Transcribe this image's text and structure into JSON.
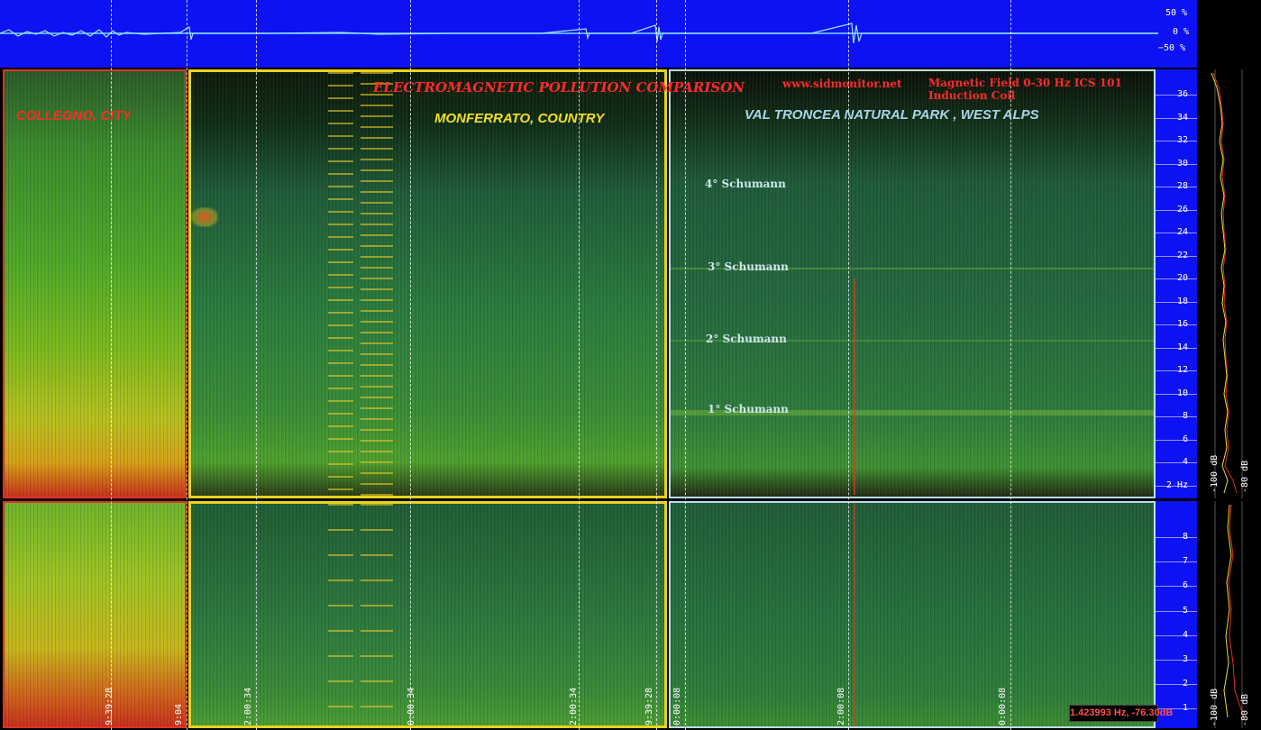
{
  "titles": {
    "main": "ELECTROMAGNETIC POLLUTION COMPARISON",
    "website": "www.sidmonitor.net",
    "sensor_line1": "Magnetic Field 0-30 Hz ICS 101",
    "sensor_line2": "Induction Coil"
  },
  "locations": {
    "city": "COLLEGNO, CITY",
    "country": "MONFERRATO, COUNTRY",
    "park": "VAL TRONCEA NATURAL PARK , WEST ALPS"
  },
  "schumann": {
    "s4": "4° Schumann",
    "s3": "3° Schumann",
    "s2": "2° Schumann",
    "s1": "1° Schumann"
  },
  "waveform_axis": {
    "plus": "50 %",
    "zero": "0 %",
    "minus": "−50 %"
  },
  "freq_axis_top": [
    "36",
    "34",
    "32",
    "30",
    "28",
    "26",
    "24",
    "22",
    "20",
    "18",
    "16",
    "14",
    "12",
    "10",
    "8",
    "6",
    "4",
    "2 Hz"
  ],
  "freq_axis_bottom": [
    "8",
    "7",
    "6",
    "5",
    "4",
    "3",
    "2",
    "1"
  ],
  "spectrum_labels": {
    "top_left": "-100 dB",
    "top_right": "-80 dB",
    "bottom_left": "-100 dB",
    "bottom_right": "-80 dB"
  },
  "time_labels": {
    "t1": "2:00:34",
    "t2": "0:00:34",
    "t3": "2:00:34",
    "t4": "9:39:28",
    "t5": "0:00:08",
    "t6": "2:00:08",
    "t7": "0:00:08",
    "t8": "2:00:08",
    "t9": "9:04"
  },
  "readout": "1.423993 Hz, -76.30dB",
  "colors": {
    "axis_blue": "#0d12f2",
    "city_border": "#e0322a",
    "country_border": "#e8d21c",
    "park_border": "#b8dce8",
    "title_red": "#ff2a2a",
    "country_yellow": "#f0e020",
    "park_light_blue": "#a8d4e6"
  }
}
